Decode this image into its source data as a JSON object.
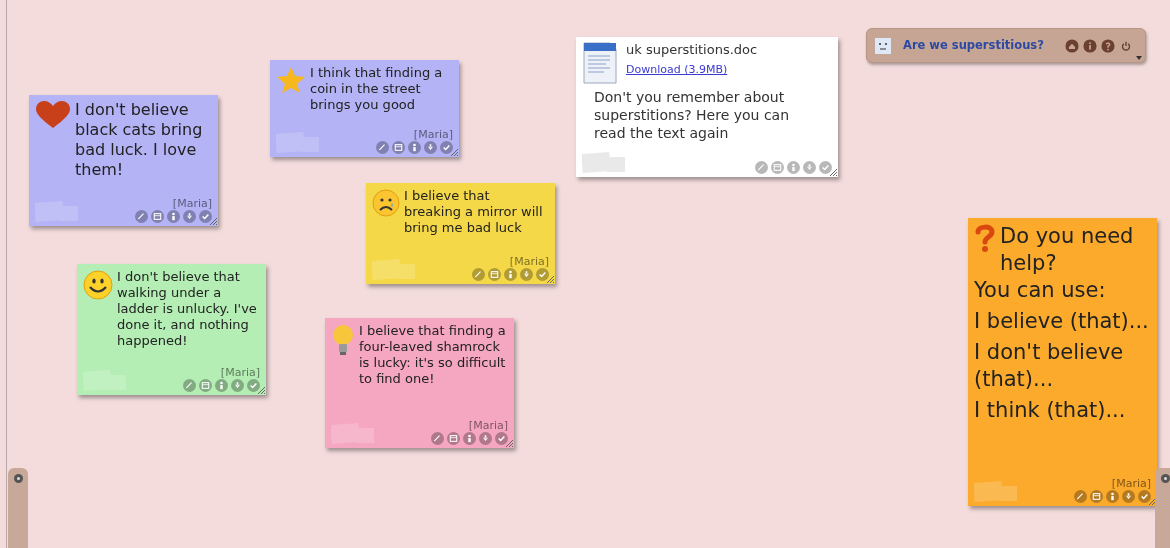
{
  "board": {
    "title": "Are we superstitious?"
  },
  "notes": [
    {
      "kind": "sticky",
      "color": "#b3b3f5",
      "text": "I don't believe black cats bring bad luck. I love them!",
      "author": "[Maria]"
    },
    {
      "kind": "sticky",
      "color": "#b3b3f5",
      "text": "I think that finding a coin in the street brings you good",
      "author": "[Maria]"
    },
    {
      "kind": "file",
      "file_name": "uk superstitions.doc",
      "link": "Download (3.9MB)",
      "text": "Don't you remember about superstitions? Here you can read the text again"
    },
    {
      "kind": "sticky",
      "color": "#f5d848",
      "text": "I believe that breaking a mirror will bring me bad luck",
      "author": "[Maria]"
    },
    {
      "kind": "sticky",
      "color": "#b4eeb4",
      "text": "I don't believe that walking under a ladder is unlucky. I've done it, and nothing happened!",
      "author": "[Maria]"
    },
    {
      "kind": "sticky",
      "color": "#f5a6c0",
      "text": "I believe that finding a four-leaved shamrock is lucky: it's so difficult to find one!",
      "author": "[Maria]"
    },
    {
      "kind": "sticky",
      "color": "#fbaa2c",
      "paragraphs": [
        "Do you need help?",
        "You can use:",
        "I believe (that)...",
        "I don't believe (that)...",
        "I think (that)..."
      ],
      "author": "[Maria]"
    }
  ]
}
